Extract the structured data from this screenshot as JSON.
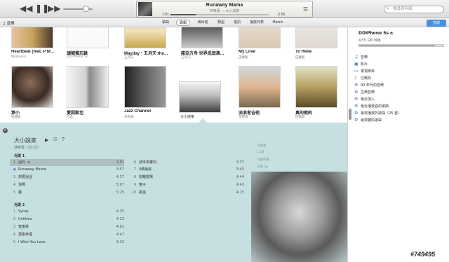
{
  "player": {
    "rewind_icon": "rewind-icon",
    "pause_icon": "pause-icon",
    "forward_icon": "forward-icon",
    "volume_level": 0.75
  },
  "now_playing": {
    "title": "Runaway Mama",
    "subtitle": "林宥嘉 — 大小說家",
    "elapsed": "1:01",
    "remaining": "-2:56",
    "progress": 0.26
  },
  "search": {
    "placeholder": "搜尋資料庫"
  },
  "toolbar": {
    "library": "♫ 音樂",
    "tabs": [
      {
        "label": "歌曲"
      },
      {
        "label": "專輯"
      },
      {
        "label": "演出者"
      },
      {
        "label": "類型"
      },
      {
        "label": "視訊"
      },
      {
        "label": "播放列表"
      },
      {
        "label": "Match"
      }
    ],
    "active_tab": "專輯",
    "done_label": "完成"
  },
  "albums_row1": [
    {
      "title": "Heartbeat (feat. P M…",
      "artist": "Wilkinson"
    },
    {
      "title": "頭號備忘錄",
      "artist": "DD iPhone 5s"
    },
    {
      "title": "Mayday・五月天 the…",
      "artist": "五月天"
    },
    {
      "title": "諾亞方舟 世界巡迴演…",
      "artist": "五月天"
    },
    {
      "title": "My Love",
      "artist": "田馥甄"
    },
    {
      "title": "To Hebe",
      "artist": "田馥甄"
    }
  ],
  "albums_row2": [
    {
      "title": "渺小",
      "artist": "田馥甄"
    },
    {
      "title": "愛因斯坦",
      "artist": "古奕"
    },
    {
      "title": "Jazz Channel",
      "artist": "林宥嘉"
    },
    {
      "title": "大小說家",
      "artist": ""
    },
    {
      "title": "流浪者吉他",
      "artist": "張震嶽"
    },
    {
      "title": "真的假的",
      "artist": "田馥甄"
    }
  ],
  "album_detail": {
    "title": "大小說家",
    "artist_year": "林宥嘉（2012）",
    "disc1_label": "光碟 1",
    "disc2_label": "光碟 2",
    "disc1_left": [
      {
        "n": "1",
        "title": "說元",
        "dur": "3:51"
      },
      {
        "n": "",
        "title": "Runaway Mama",
        "dur": "3:57"
      },
      {
        "n": "3",
        "title": "想要說話",
        "dur": "4:37"
      },
      {
        "n": "4",
        "title": "浪費",
        "dur": "5:07"
      },
      {
        "n": "5",
        "title": "貓",
        "dur": "5:25"
      }
    ],
    "disc1_right": [
      {
        "n": "6",
        "title": "請未來審判",
        "dur": "3:37"
      },
      {
        "n": "7",
        "title": "4號病房",
        "dur": "3:45"
      },
      {
        "n": "8",
        "title": "想離開場",
        "dur": "4:44"
      },
      {
        "n": "9",
        "title": "傻子",
        "dur": "4:43"
      },
      {
        "n": "10",
        "title": "拒黑",
        "dur": "4:15"
      }
    ],
    "disc2_left": [
      {
        "n": "1",
        "title": "Syrup",
        "dur": "4:35"
      },
      {
        "n": "2",
        "title": "Untitles",
        "dur": "4:23"
      },
      {
        "n": "3",
        "title": "蜜蜜歌",
        "dur": "4:01"
      },
      {
        "n": "4",
        "title": "愛甜幸福",
        "dur": "4:47"
      },
      {
        "n": "5",
        "title": "I Wish You Love",
        "dur": "4:32"
      }
    ],
    "lyric_lines": [
      "小說家",
      "1:18",
      "小說作家",
      "小說 Lyr"
    ]
  },
  "device": {
    "name": "DDiPhone 5s",
    "capacity": "4.55 GB 可用",
    "used_fraction": 0.9
  },
  "sidebar_items": [
    {
      "icon": "music-note-icon",
      "glyph": "♫",
      "label": "音樂"
    },
    {
      "icon": "film-icon",
      "glyph": "▣",
      "label": "影片"
    },
    {
      "icon": "tv-icon",
      "glyph": "▭",
      "label": "電視節目"
    },
    {
      "icon": "bell-icon",
      "glyph": "♪",
      "label": "已購買"
    },
    {
      "icon": "gear-icon",
      "glyph": "⚙",
      "label": "90 年代的音樂"
    },
    {
      "icon": "gear-icon",
      "glyph": "⚙",
      "label": "古典音樂"
    },
    {
      "icon": "gear-icon",
      "glyph": "⚙",
      "label": "最近加入"
    },
    {
      "icon": "gear-icon",
      "glyph": "⚙",
      "label": "最近播放過的歌曲"
    },
    {
      "icon": "gear-icon",
      "glyph": "⚙",
      "label": "最常播放的歌曲（25 首）"
    },
    {
      "icon": "gear-icon",
      "glyph": "⚙",
      "label": "最常聽的歌曲"
    }
  ],
  "watermark": "#749495"
}
